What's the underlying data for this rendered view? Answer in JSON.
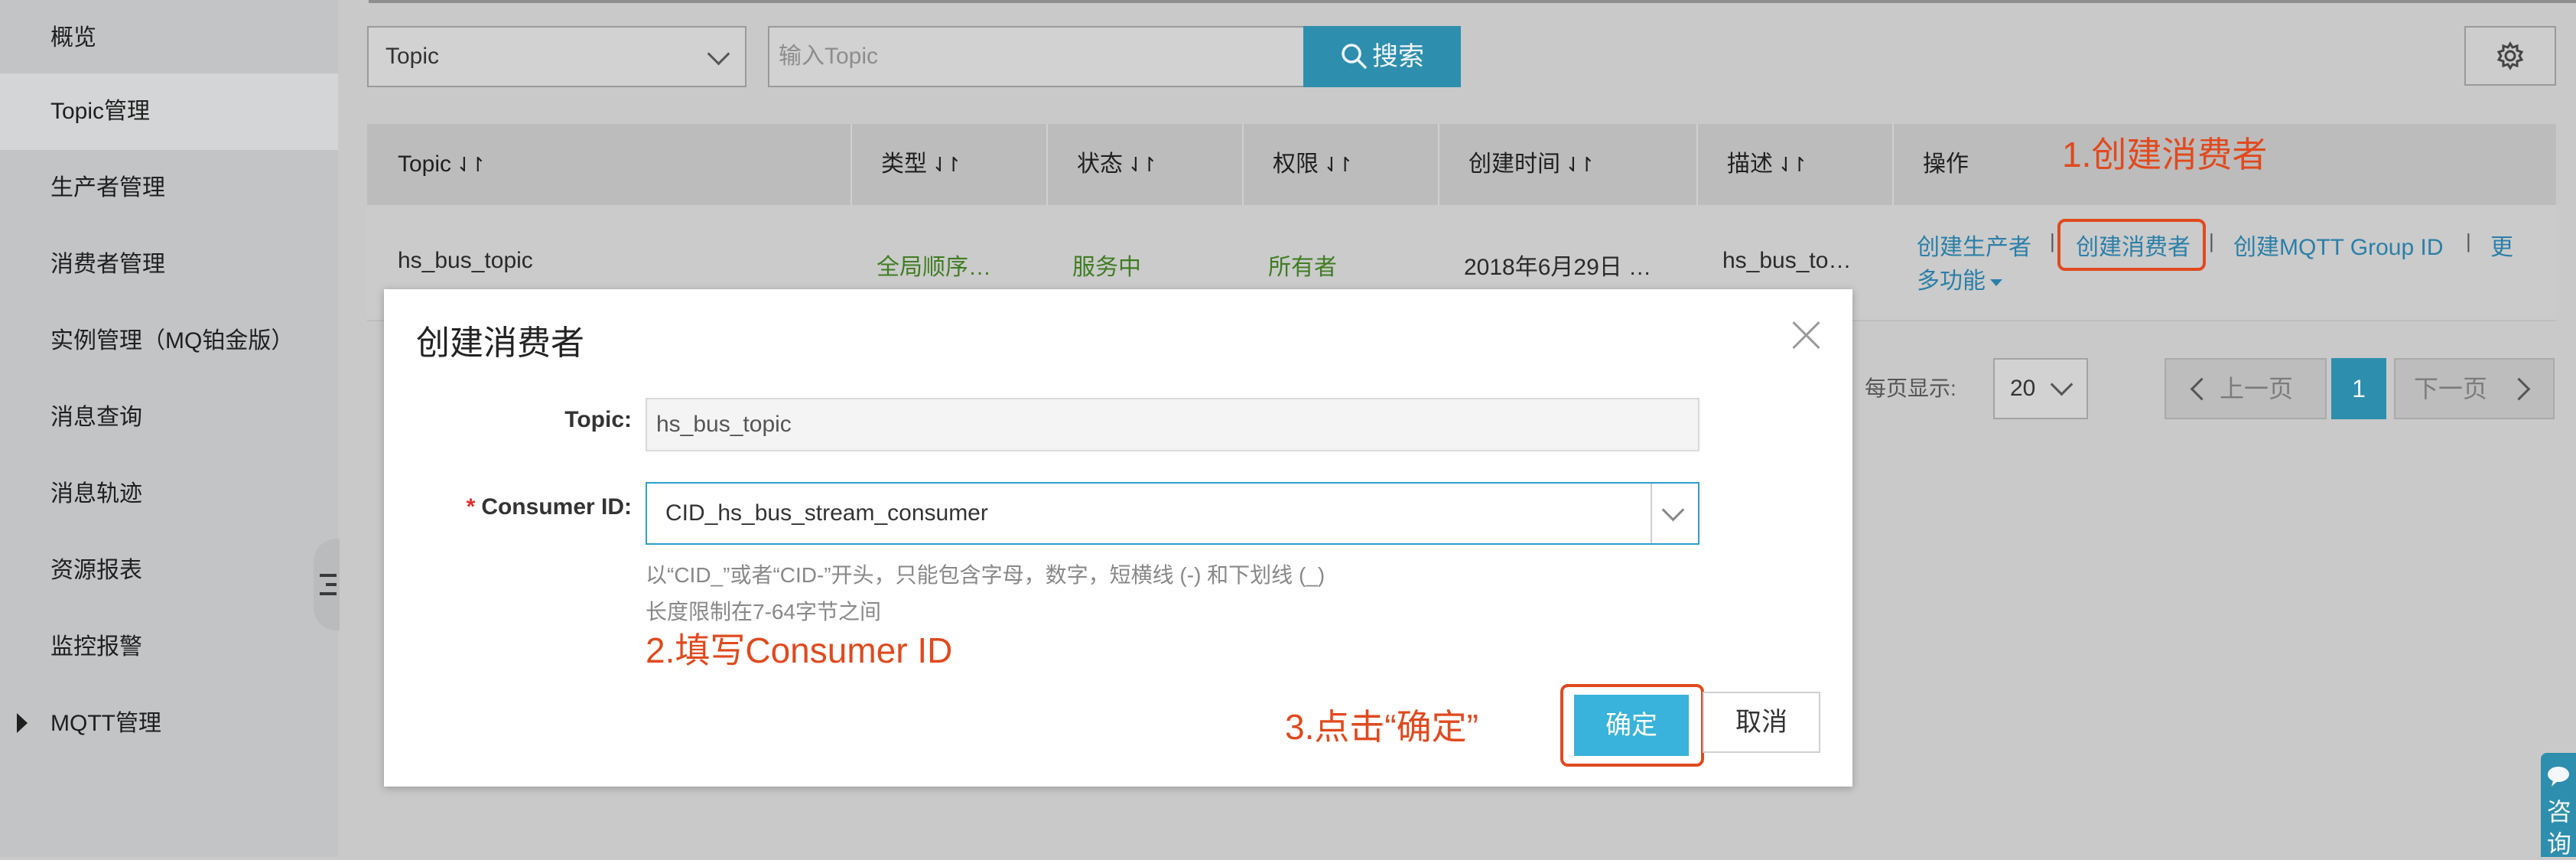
{
  "sidebar": {
    "items": [
      {
        "label": "概览"
      },
      {
        "label": "Topic管理"
      },
      {
        "label": "生产者管理"
      },
      {
        "label": "消费者管理"
      },
      {
        "label": "实例管理（MQ铂金版）"
      },
      {
        "label": "消息查询"
      },
      {
        "label": "消息轨迹"
      },
      {
        "label": "资源报表"
      },
      {
        "label": "监控报警"
      },
      {
        "label": "MQTT管理"
      }
    ],
    "active_index": 1
  },
  "toolbar": {
    "filter_select": "Topic",
    "search_placeholder": "输入Topic",
    "search_label": "搜索"
  },
  "table": {
    "headers": [
      "Topic",
      "类型",
      "状态",
      "权限",
      "创建时间",
      "描述",
      "操作"
    ],
    "sort_icon": "⇃↾",
    "row": {
      "topic": "hs_bus_topic",
      "type": "全局顺序…",
      "status": "服务中",
      "permission": "所有者",
      "created": "2018年6月29日 …",
      "description": "hs_bus_to…",
      "actions": [
        "创建生产者",
        "创建消费者",
        "创建MQTT Group ID",
        "更",
        "多功能"
      ]
    }
  },
  "pagination": {
    "per_page_label": "每页显示:",
    "per_page_value": "20",
    "prev_label": "上一页",
    "current_page": "1",
    "next_label": "下一页"
  },
  "consult": {
    "label": "咨询"
  },
  "dialog": {
    "title": "创建消费者",
    "topic_label": "Topic:",
    "topic_value": "hs_bus_topic",
    "consumer_required": "*",
    "consumer_label": "Consumer ID:",
    "consumer_value": "CID_hs_bus_stream_consumer",
    "hint1": "以“CID_”或者“CID-”开头，只能包含字母，数字，短横线 (-) 和下划线 (_)",
    "hint2": "长度限制在7-64字节之间",
    "ok_label": "确定",
    "cancel_label": "取消"
  },
  "annotations": {
    "step1": "1.创建消费者",
    "step2": "2.填写Consumer ID",
    "step3": "3.点击“确定”"
  },
  "colors": {
    "accent": "#2e8eae",
    "primary_button": "#39b2dc",
    "annotation": "#e04a1f",
    "link": "#2b7fa8",
    "status_green": "#3f7d22"
  }
}
